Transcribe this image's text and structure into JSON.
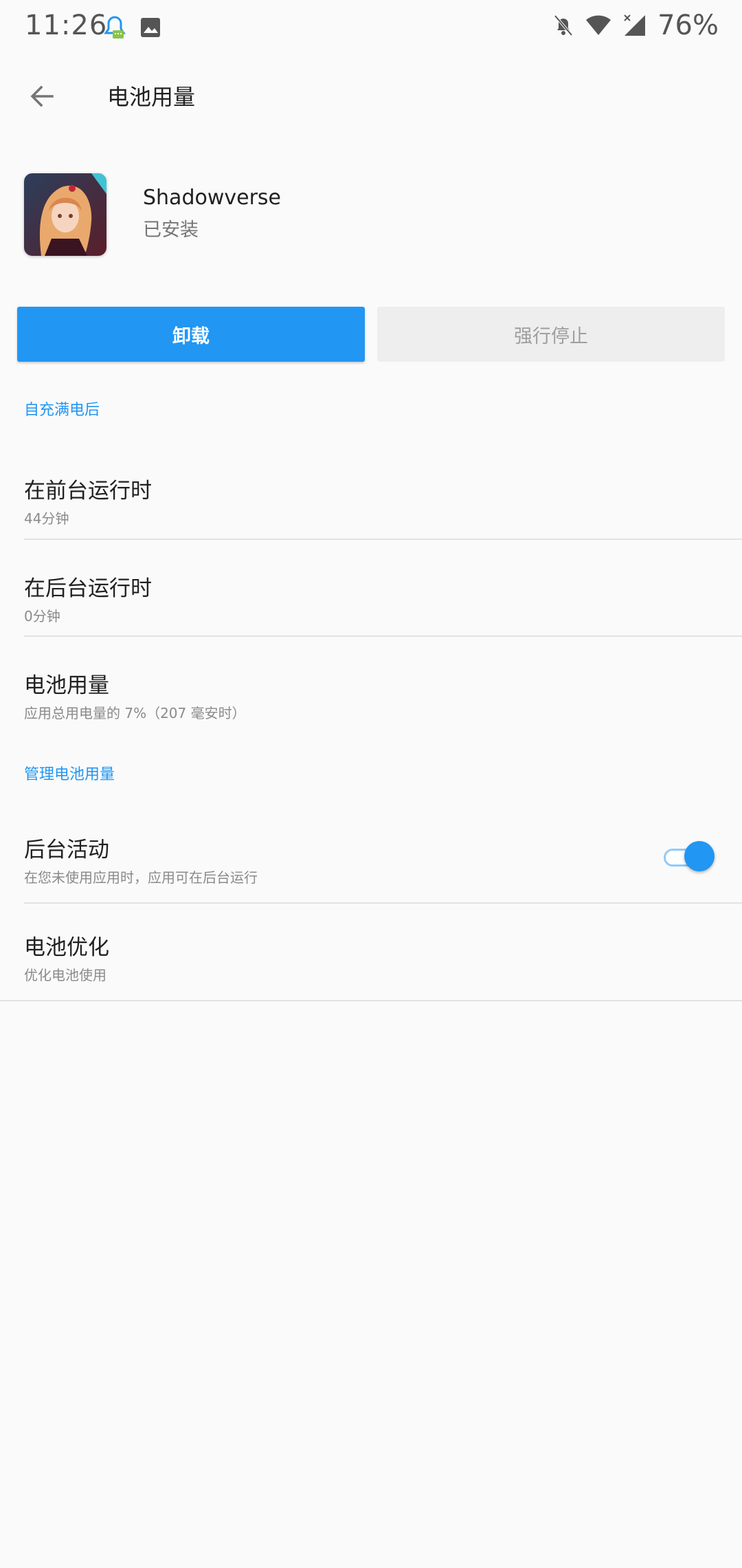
{
  "status_bar": {
    "time": "11:26",
    "battery": "76%",
    "left_icons": [
      "qq-notification-icon",
      "image-icon"
    ],
    "right_icons": [
      "do-not-disturb-icon",
      "wifi-icon",
      "signal-icon"
    ]
  },
  "app_bar": {
    "title": "电池用量",
    "back_icon": "arrow-back-icon"
  },
  "app": {
    "name": "Shadowverse",
    "status": "已安装"
  },
  "buttons": {
    "uninstall": "卸载",
    "force_stop": "强行停止"
  },
  "sections": {
    "since_full_charge": {
      "header": "自充满电后",
      "items": [
        {
          "title": "在前台运行时",
          "subtitle": "44分钟"
        },
        {
          "title": "在后台运行时",
          "subtitle": "0分钟"
        },
        {
          "title": "电池用量",
          "subtitle": "应用总用电量的 7%（207 毫安时）"
        }
      ]
    },
    "manage": {
      "header": "管理电池用量",
      "items": [
        {
          "title": "后台活动",
          "subtitle": "在您未使用应用时，应用可在后台运行",
          "toggle_on": true
        },
        {
          "title": "电池优化",
          "subtitle": "优化电池使用"
        }
      ]
    }
  },
  "colors": {
    "accent": "#2196f3",
    "background": "#fafafa"
  }
}
